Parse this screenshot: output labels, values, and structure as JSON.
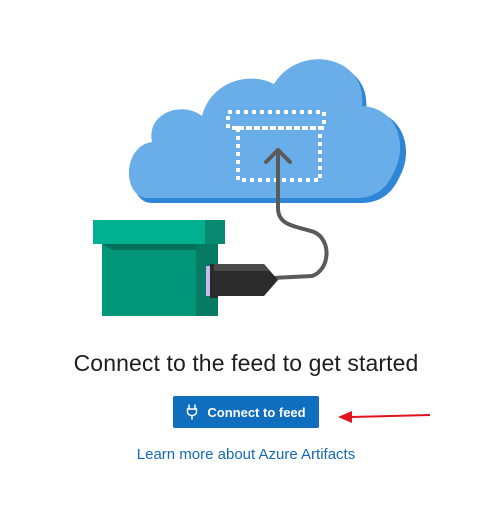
{
  "empty_state": {
    "headline": "Connect to the feed to get started",
    "connect_button": {
      "label": "Connect to feed",
      "icon": "plug-icon"
    },
    "learn_link": "Learn more about Azure Artifacts"
  },
  "colors": {
    "primary_button": "#106ebe",
    "link": "#1469b8",
    "cloud": "#69aee9",
    "cloud_shadow": "#2f86d6",
    "package": "#00a07f",
    "annotation_arrow": "#e0141e"
  }
}
